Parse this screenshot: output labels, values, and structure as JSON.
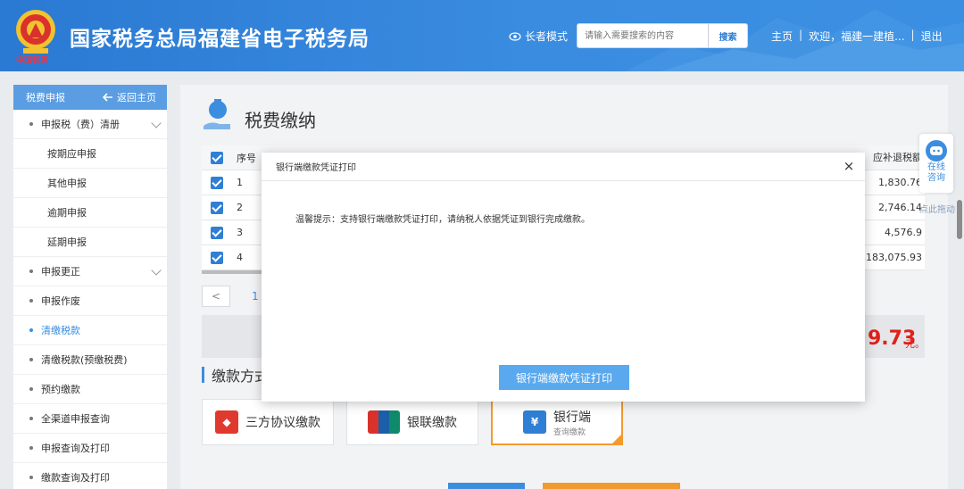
{
  "header": {
    "emblem_text": "中国税务",
    "title": "国家税务总局福建省电子税务局",
    "elder_mode": "长者模式",
    "search_placeholder": "请输入需要搜索的内容",
    "search_button": "搜索",
    "home": "主页",
    "welcome": "欢迎，福建一建植...",
    "logout": "退出",
    "separator": "|"
  },
  "sidebar": {
    "title": "税费申报",
    "back": "返回主页",
    "items": [
      {
        "label": "申报税（费）清册"
      },
      {
        "label": "按期应申报"
      },
      {
        "label": "其他申报"
      },
      {
        "label": "逾期申报"
      },
      {
        "label": "延期申报"
      },
      {
        "label": "申报更正"
      },
      {
        "label": "申报作废"
      },
      {
        "label": "清缴税款"
      },
      {
        "label": "清缴税款(预缴税费)"
      },
      {
        "label": "预约缴款"
      },
      {
        "label": "全渠道申报查询"
      },
      {
        "label": "申报查询及打印"
      },
      {
        "label": "缴款查询及打印"
      }
    ]
  },
  "main": {
    "title": "税费缴纳",
    "table": {
      "col_no": "序号",
      "col_amount": "应补退税额",
      "rows": [
        {
          "no": "1",
          "amount": "1,830.76"
        },
        {
          "no": "2",
          "amount": "2,746.14"
        },
        {
          "no": "3",
          "amount": "4,576.9"
        },
        {
          "no": "4",
          "amount": "183,075.93"
        }
      ]
    },
    "pager": {
      "prev": "<",
      "page": "1"
    },
    "total_amount": "9.73",
    "total_unit": "元。",
    "pay_section": "缴款方式",
    "pay_methods": [
      {
        "label": "三方协议缴款",
        "sub": ""
      },
      {
        "label": "银联缴款",
        "sub": ""
      },
      {
        "label": "银行端",
        "sub": "查询缴款"
      }
    ]
  },
  "consult": {
    "line1": "在线",
    "line2": "咨询",
    "drag_hint": "点此拖动"
  },
  "modal": {
    "title": "银行端缴款凭证打印",
    "close": "×",
    "tip": "温馨提示：支持银行端缴款凭证打印，请纳税人依据凭证到银行完成缴款。",
    "button": "银行端缴款凭证打印"
  }
}
